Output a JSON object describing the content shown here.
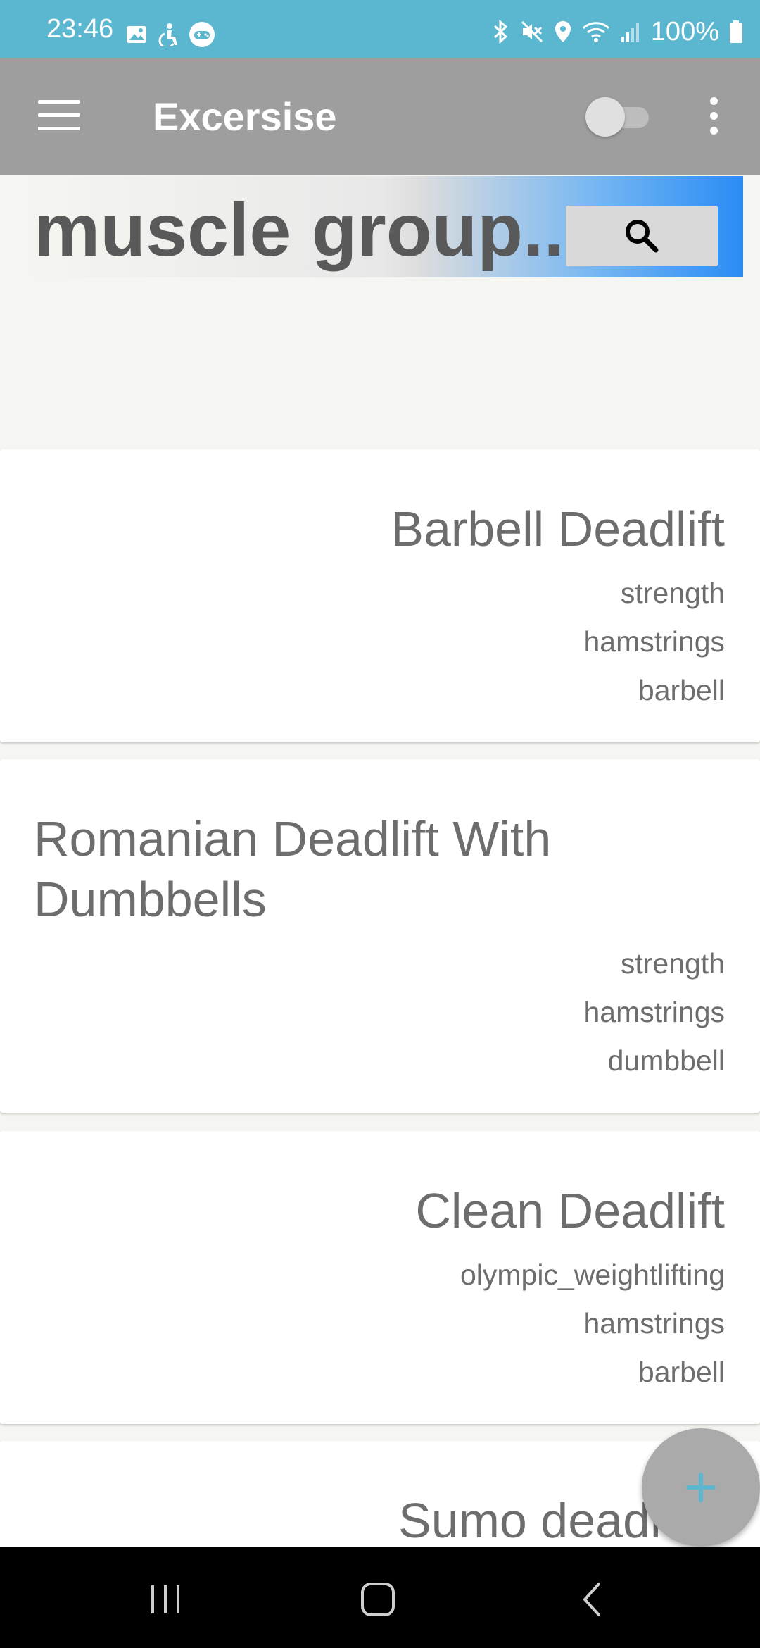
{
  "status_bar": {
    "time": "23:46",
    "battery": "100%",
    "left_icons": [
      "gallery-icon",
      "accessibility-icon",
      "game-icon"
    ],
    "right_icons": [
      "bluetooth-icon",
      "mute-icon",
      "location-icon",
      "wifi-icon",
      "signal-icon",
      "battery-icon"
    ]
  },
  "app_bar": {
    "title": "Excersise",
    "toggle_on": false
  },
  "search": {
    "placeholder": "muscle group..."
  },
  "exercises": [
    {
      "name": "Barbell Deadlift",
      "type": "strength",
      "muscle": "hamstrings",
      "equipment": "barbell"
    },
    {
      "name": "Romanian Deadlift With Dumbbells",
      "type": "strength",
      "muscle": "hamstrings",
      "equipment": "dumbbell"
    },
    {
      "name": "Clean Deadlift",
      "type": "olympic_weightlifting",
      "muscle": "hamstrings",
      "equipment": "barbell"
    },
    {
      "name": "Sumo deadl"
    }
  ],
  "colors": {
    "status_bar": "#5bb7d0",
    "app_bar": "#9e9e9e",
    "fab": "#aaaaaa",
    "fab_plus": "#5bb7d0"
  }
}
